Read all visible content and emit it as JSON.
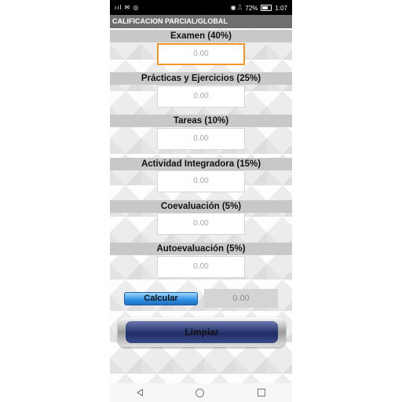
{
  "status_bar": {
    "left_icons": "ııl ✉ ◎",
    "right_icons": "◉ ⎍",
    "battery": "72%",
    "time": "1:07"
  },
  "app": {
    "title": "CALIFICACION PARCIAL/GLOBAL"
  },
  "sections": [
    {
      "label": "Examen (40%)",
      "value": "0.00"
    },
    {
      "label": "Prácticas y Ejercicios (25%)",
      "value": "0.00"
    },
    {
      "label": "Tareas (10%)",
      "value": "0.00"
    },
    {
      "label": "Actividad Integradora (15%)",
      "value": "0.00"
    },
    {
      "label": "Coevaluación (5%)",
      "value": "0.00"
    },
    {
      "label": "Autoevaluación (5%)",
      "value": "0.00"
    }
  ],
  "actions": {
    "calculate_label": "Calcular",
    "result_value": "0.00",
    "clear_label": "Limpiar"
  },
  "nav_icons": [
    "back-icon",
    "home-icon",
    "recent-apps-icon"
  ]
}
